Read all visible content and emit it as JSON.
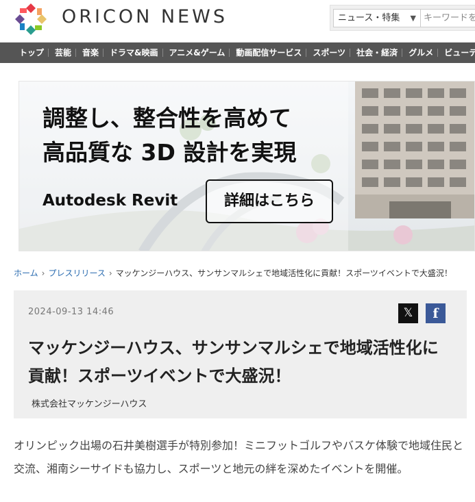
{
  "header": {
    "brand": "ORICON NEWS",
    "search_category": "ニュース・特集",
    "search_placeholder": "キーワードを"
  },
  "nav": {
    "items": [
      {
        "label": "トップ"
      },
      {
        "label": "芸能"
      },
      {
        "label": "音楽"
      },
      {
        "label": "ドラマ&映画"
      },
      {
        "label": "アニメ&ゲーム"
      },
      {
        "label": "動画配信サービス"
      },
      {
        "label": "スポーツ"
      },
      {
        "label": "社会・経済"
      },
      {
        "label": "グルメ"
      },
      {
        "label": "ビューテ"
      }
    ]
  },
  "ad": {
    "headline_1": "調整し、整合性を高めて",
    "headline_2": "高品質な 3D 設計を実現",
    "product": "Autodesk Revit",
    "cta": "詳細はこちら"
  },
  "breadcrumb": {
    "home": "ホーム",
    "section": "プレスリリース",
    "current": "マッケンジーハウス、サンサンマルシェで地域活性化に貢献！スポーツイベントで大盛況！"
  },
  "article": {
    "date": "2024-09-13 14:46",
    "title": "マッケンジーハウス、サンサンマルシェで地域活性化に貢献！スポーツイベントで大盛況！",
    "company": "株式会社マッケンジーハウス",
    "lead": "オリンピック出場の石井美樹選手が特別参加！ミニフットゴルフやバスケ体験で地域住民と交流、湘南シーサイドも協力し、スポーツと地元の絆を深めたイベントを開催。"
  },
  "share": {
    "x_glyph": "𝕏",
    "fb_glyph": "f"
  },
  "colors": {
    "nav_bg": "#555555",
    "link": "#2b6cb0",
    "card_bg": "#efefef",
    "facebook": "#3b5998"
  }
}
